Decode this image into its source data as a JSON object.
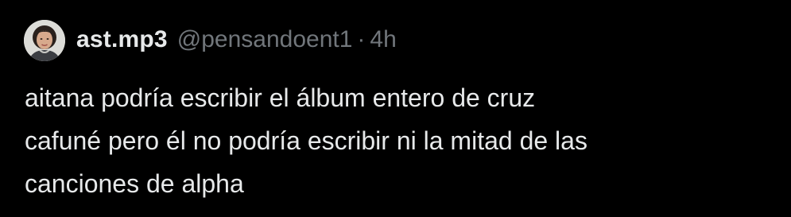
{
  "tweet": {
    "author": {
      "display_name": "ast.mp3",
      "handle": "@pensandoent1",
      "avatar_icon": "profile-photo"
    },
    "separator": "·",
    "time_ago": "4h",
    "text": "aitana podría escribir el álbum entero de cruz\ncafuné pero él no podría escribir ni la mitad de las\ncanciones de alpha"
  },
  "colors": {
    "background": "#000000",
    "primary_text": "#e7e9ea",
    "secondary_text": "#71767b"
  }
}
